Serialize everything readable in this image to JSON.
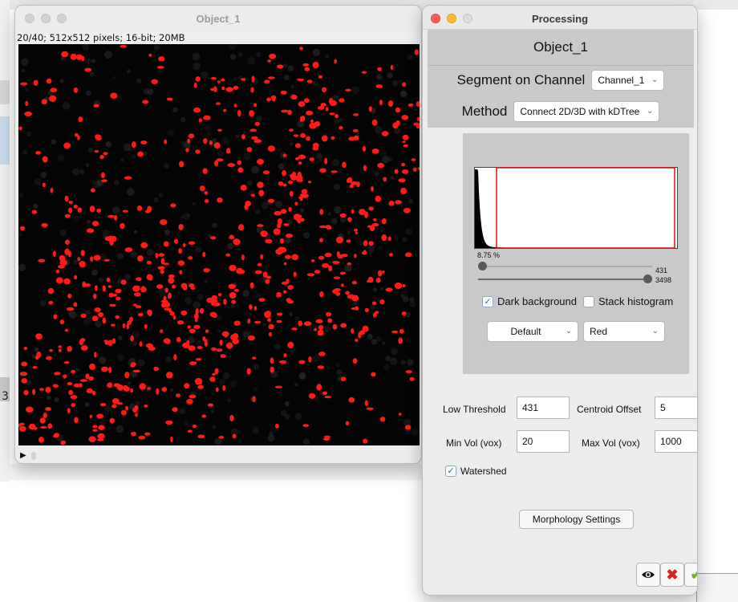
{
  "image_window": {
    "title": "Object_1",
    "info": "20/40; 512x512 pixels; 16-bit; 20MB"
  },
  "desktop": {
    "edge_digit": "3"
  },
  "processing_window": {
    "title": "Processing",
    "object_name": "Object_1",
    "segment": {
      "label": "Segment on Channel",
      "channel_value": "Channel_1"
    },
    "method": {
      "label": "Method",
      "value": "Connect 2D/3D with kDTree"
    },
    "histogram": {
      "percent_label": "8.75 %",
      "low_slider": {
        "value": "431",
        "fraction": 0.0
      },
      "high_slider": {
        "value": "3498",
        "fraction": 1.0
      },
      "dark_background": {
        "label": "Dark background",
        "checked": true
      },
      "stack_histogram": {
        "label": "Stack histogram",
        "checked": false
      },
      "threshold_method": "Default",
      "lut_color": "Red"
    },
    "fields": {
      "low_threshold": {
        "label": "Low Threshold",
        "value": "431"
      },
      "centroid_offset": {
        "label": "Centroid Offset",
        "value": "5"
      },
      "min_vol": {
        "label": "Min Vol (vox)",
        "value": "20"
      },
      "max_vol": {
        "label": "Max Vol (vox)",
        "value": "1000"
      }
    },
    "watershed": {
      "label": "Watershed",
      "checked": true
    },
    "morphology_button": "Morphology Settings",
    "actions": {
      "preview_icon": "eye-icon",
      "cancel_icon": "cross-icon",
      "ok_icon": "checkmark-icon",
      "cancel_color": "#d42626",
      "ok_color": "#6bb331"
    }
  },
  "colors": {
    "threshold_red": "#ff1a1a",
    "panel_gray": "#c9c9c9"
  }
}
